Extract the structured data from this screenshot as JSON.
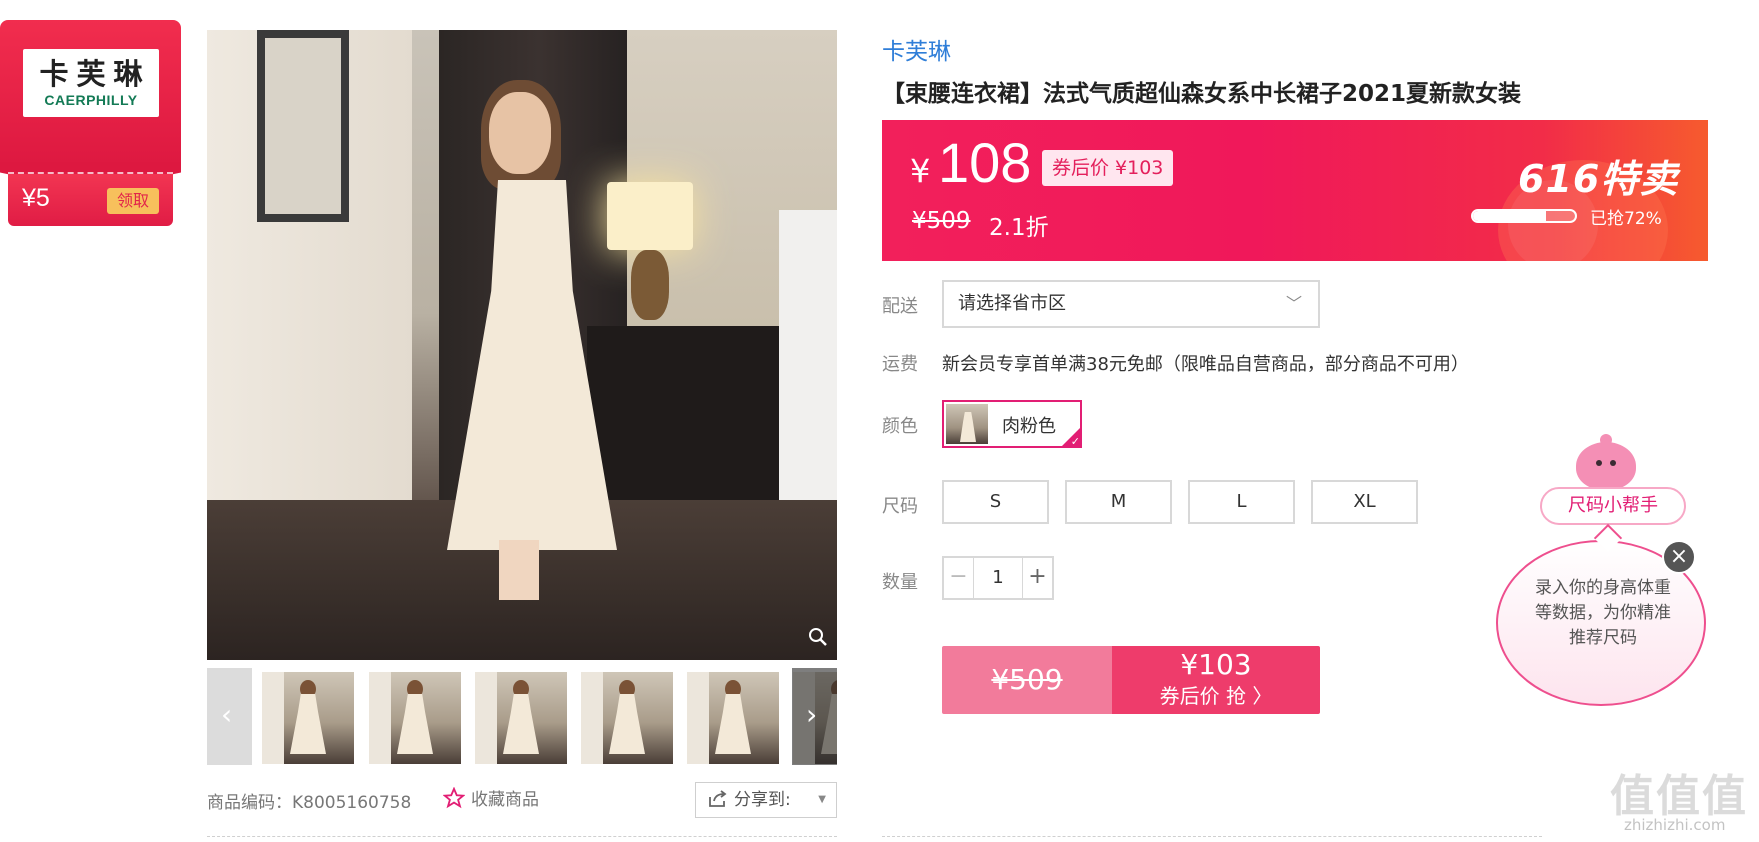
{
  "coupon": {
    "brand_cn": "卡芙琳",
    "brand_en": "CAERPHILLY",
    "amount": "¥5",
    "claim_label": "领取"
  },
  "gallery": {
    "prev_icon": "chevron-left",
    "next_icon": "chevron-right",
    "zoom_icon": "magnifier",
    "thumb_count": 6,
    "sku_label": "商品编码：K8005160758",
    "favorite_label": "收藏商品",
    "share_label": "分享到:"
  },
  "product": {
    "brand": "卡芙琳",
    "title": "【束腰连衣裙】法式气质超仙森女系中长裙子2021夏新款女装"
  },
  "price": {
    "yen_symbol": "¥",
    "current": "108",
    "coupon_price": "券后价 ¥103",
    "original": "¥509",
    "discount": "2.1折",
    "event": "616特卖",
    "sold_label": "已抢72%",
    "sold_fraction": 0.72,
    "colors": {
      "banner_start": "#f2205b",
      "banner_end": "#f65b2e"
    }
  },
  "options": {
    "delivery_label": "配送",
    "delivery_placeholder": "请选择省市区",
    "shipping_label": "运费",
    "shipping_text": "新会员专享首单满38元免邮（限唯品自营商品，部分商品不可用）",
    "color_label": "颜色",
    "color_selected": "肉粉色",
    "size_label": "尺码",
    "sizes": [
      "S",
      "M",
      "L",
      "XL"
    ],
    "quantity_label": "数量",
    "quantity_value": "1",
    "minus": "−",
    "plus": "+"
  },
  "buy": {
    "original": "¥509",
    "price": "¥103",
    "sub_label": "券后价 抢 〉"
  },
  "size_helper": {
    "label": "尺码小帮手",
    "text": "录入你的身高体重等数据，为你精准推荐尺码",
    "close": "×"
  },
  "watermark": {
    "big": "值值值",
    "small": "zhizhizhi.com"
  }
}
